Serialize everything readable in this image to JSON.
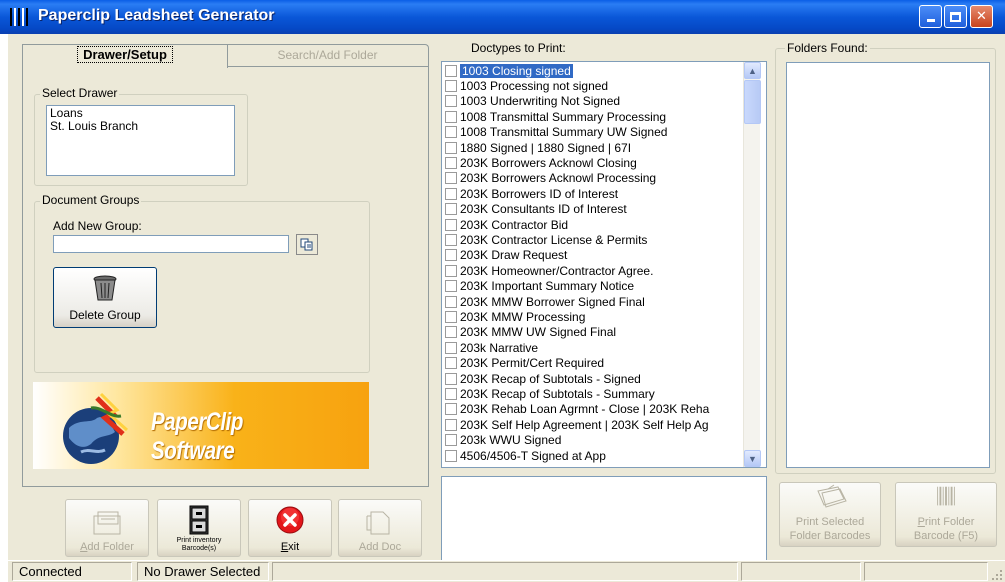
{
  "window": {
    "title": "Paperclip Leadsheet Generator"
  },
  "tabs": [
    {
      "label": "Drawer/Setup",
      "active": true
    },
    {
      "label": "Search/Add Folder",
      "active": false
    }
  ],
  "select_drawer": {
    "legend": "Select Drawer",
    "items": [
      "Loans",
      "St. Louis Branch"
    ]
  },
  "document_groups": {
    "legend": "Document Groups",
    "add_label": "Add New Group:",
    "input_value": "",
    "delete_label": "Delete Group"
  },
  "banner": {
    "text": "PaperClip Software"
  },
  "toolbar": {
    "add_folder": "Add Folder",
    "print_inventory_line1": "Print inventory",
    "print_inventory_line2": "Barcode(s)",
    "exit": "Exit",
    "add_doc": "Add Doc"
  },
  "doctypes": {
    "label": "Doctypes to Print:",
    "items": [
      "1003 Closing signed",
      "1003 Processing not signed",
      "1003 Underwriting Not Signed",
      "1008 Transmittal Summary Processing",
      "1008 Transmittal Summary UW Signed",
      "1880 Signed | 1880 Signed | 67I",
      "203K Borrowers Acknowl Closing",
      "203K Borrowers Acknowl Processing",
      "203K Borrowers ID of Interest",
      "203K Consultants ID of Interest",
      "203K Contractor Bid",
      "203K Contractor License & Permits",
      "203K Draw Request",
      "203K Homeowner/Contractor Agree.",
      "203K Important Summary Notice",
      "203K MMW Borrower Signed Final",
      "203K MMW Processing",
      "203K MMW UW Signed Final",
      "203k Narrative",
      "203K Permit/Cert Required",
      "203K Recap of Subtotals - Signed",
      "203K Recap of Subtotals - Summary",
      "203K Rehab Loan Agrmnt - Close | 203K Reha",
      "203K Self Help Agreement | 203K Self Help Ag",
      "203k WWU Signed",
      "4506/4506-T Signed at App"
    ],
    "selected_index": 0
  },
  "folders": {
    "label": "Folders Found:",
    "print_selected_line1": "Print Selected",
    "print_selected_line2": "Folder Barcodes",
    "print_folder_line1": "Print Folder",
    "print_folder_line2": "Barcode (F5)"
  },
  "status": {
    "connection": "Connected",
    "drawer": "No Drawer Selected"
  },
  "colors": {
    "titlebar": "#0a57d8",
    "window_bg": "#ece9d8",
    "selection": "#316ac5",
    "banner_orange": "#f7a20f"
  }
}
